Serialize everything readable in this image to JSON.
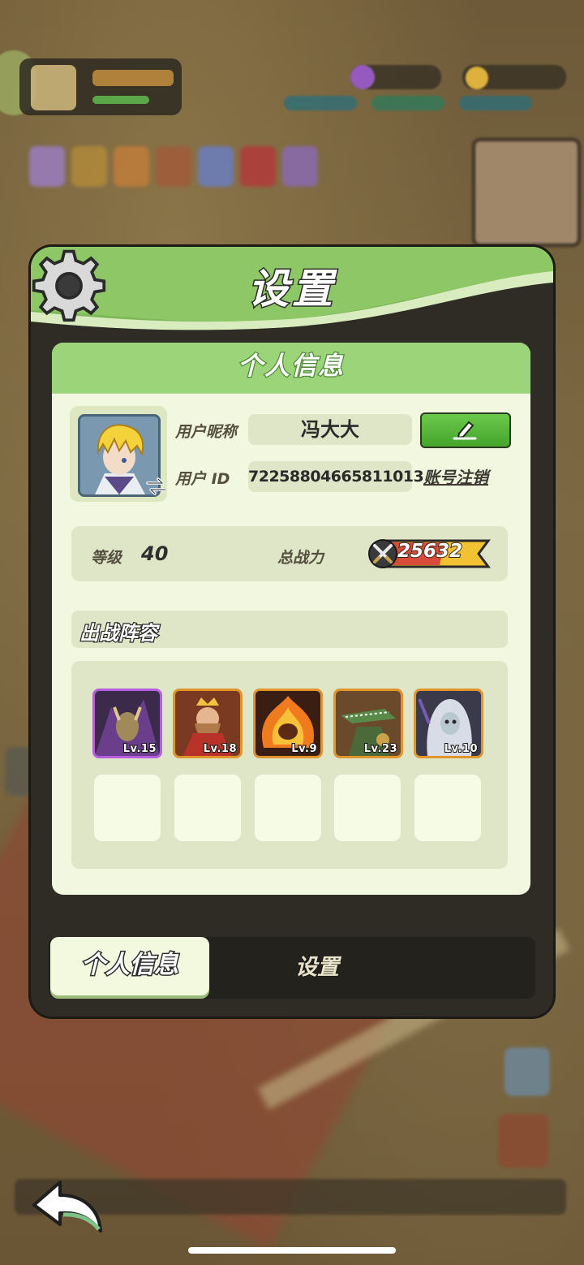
{
  "colors": {
    "header_green": "#7fb85a",
    "panel_bg": "#f2f8df",
    "field_bg": "#dfe6c8",
    "edit_green": "#44a42c",
    "power_red": "#d84a3a",
    "power_yellow": "#f2c233"
  },
  "dialog": {
    "title": "设置",
    "icon": "gear-icon"
  },
  "profile": {
    "section_title": "个人信息",
    "nickname_label": "用户昵称",
    "nickname": "冯大大",
    "id_label": "用户 ID",
    "user_id": "72258804665811013",
    "logout_label": "账号注销",
    "edit_icon": "pencil-icon",
    "swap_icon": "swap-arrows-icon"
  },
  "stats": {
    "level_label": "等级",
    "level": "40",
    "power_label": "总战力",
    "power": "25632",
    "power_icon": "crossed-swords-icon"
  },
  "team": {
    "title": "出战阵容",
    "heroes": [
      {
        "level": "Lv.15",
        "rarity": "purple"
      },
      {
        "level": "Lv.18",
        "rarity": "orange"
      },
      {
        "level": "Lv.9",
        "rarity": "orange"
      },
      {
        "level": "Lv.23",
        "rarity": "orange"
      },
      {
        "level": "Lv.10",
        "rarity": "orange"
      }
    ],
    "empty_slots": 5
  },
  "tabs": {
    "profile": "个人信息",
    "settings": "设置",
    "active": "profile"
  },
  "back_icon": "back-arrow-icon"
}
